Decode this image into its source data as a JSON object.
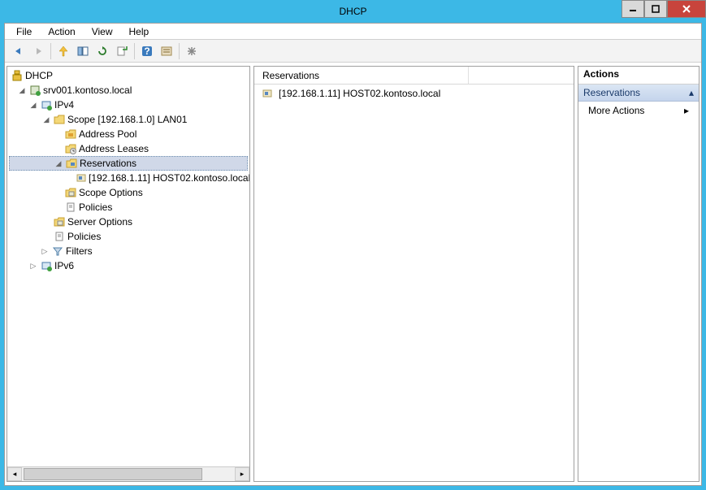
{
  "window": {
    "title": "DHCP"
  },
  "menu": {
    "file": "File",
    "action": "Action",
    "view": "View",
    "help": "Help"
  },
  "tree": {
    "root": "DHCP",
    "server": "srv001.kontoso.local",
    "ipv4": "IPv4",
    "scope": "Scope [192.168.1.0] LAN01",
    "address_pool": "Address Pool",
    "address_leases": "Address Leases",
    "reservations": "Reservations",
    "reservation_item": "[192.168.1.11] HOST02.kontoso.local",
    "scope_options": "Scope Options",
    "policies": "Policies",
    "server_options": "Server Options",
    "server_policies": "Policies",
    "filters": "Filters",
    "ipv6": "IPv6"
  },
  "list": {
    "header": "Reservations",
    "items": [
      {
        "label": "[192.168.1.11] HOST02.kontoso.local"
      }
    ]
  },
  "actions": {
    "header": "Actions",
    "section": "Reservations",
    "more": "More Actions"
  }
}
